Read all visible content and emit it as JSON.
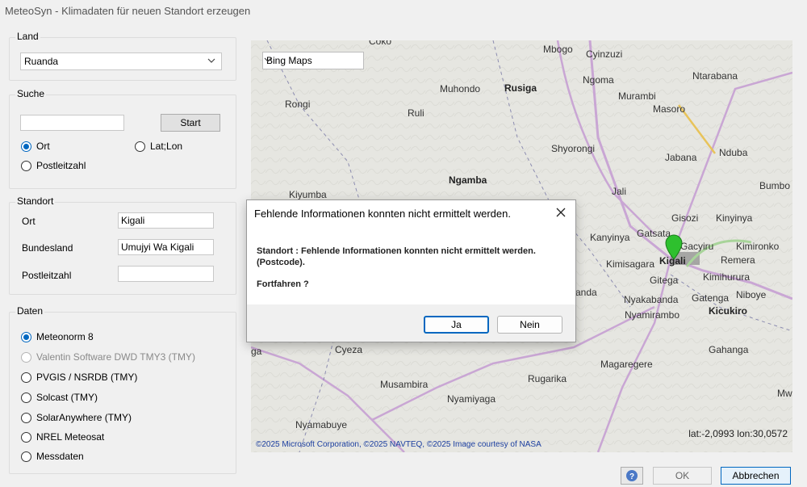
{
  "window": {
    "title": "MeteoSyn - Klimadaten für neuen Standort erzeugen"
  },
  "land": {
    "label": "Land",
    "selected": "Ruanda"
  },
  "suche": {
    "label": "Suche",
    "input_value": "",
    "start_label": "Start",
    "options": [
      "Ort",
      "Lat;Lon",
      "Postleitzahl"
    ],
    "selected": "Ort"
  },
  "standort": {
    "label": "Standort",
    "fields": [
      {
        "label": "Ort",
        "value": "Kigali"
      },
      {
        "label": "Bundesland",
        "value": "Umujyi Wa Kigali"
      },
      {
        "label": "Postleitzahl",
        "value": ""
      }
    ]
  },
  "daten": {
    "label": "Daten",
    "options": [
      "Meteonorm 8",
      "Valentin Software DWD TMY3 (TMY)",
      "PVGIS / NSRDB (TMY)",
      "Solcast (TMY)",
      "SolarAnywhere (TMY)",
      "NREL Meteosat",
      "Messdaten"
    ],
    "selected": "Meteonorm 8",
    "disabled": "Valentin Software DWD TMY3 (TMY)"
  },
  "map": {
    "provider": "Bing Maps",
    "places": [
      "Coko",
      "Mbogo",
      "Cyinzuzi",
      "Ngoma",
      "Ntarabana",
      "Muhondo",
      "Rusiga",
      "Murambi",
      "Rongi",
      "Ruli",
      "Masoro",
      "Shyorongi",
      "Jabana",
      "Nduba",
      "Ngamba",
      "Kiyumba",
      "Jali",
      "Bumbo",
      "Gisozi",
      "Kinyinya",
      "Kanyinya",
      "Gatsata",
      "Gacyiru",
      "Kimironko",
      "Kimisagara",
      "Kigali",
      "Remera",
      "Gitega",
      "Kimihurura",
      "Nyakabanda",
      "Gatenga",
      "Niboye",
      "Nyamirambo",
      "Kicukiro",
      "Gahanga",
      "Magaregere",
      "Cyeza",
      "Musambira",
      "Rugarika",
      "Nyamiyaga",
      "Nyamabuye",
      "Mwo",
      "anda",
      "ga"
    ],
    "copyright": "©2025 Microsoft Corporation, ©2025 NAVTEQ, ©2025 Image courtesy of NASA",
    "coords": "lat:-2,0993 lon:30,0572"
  },
  "dialog": {
    "title": "Fehlende Informationen konnten nicht ermittelt werden.",
    "message_line1": "Standort : Fehlende Informationen konnten nicht ermittelt werden.",
    "message_line2": "(Postcode).",
    "question": "Fortfahren ?",
    "yes_label": "Ja",
    "no_label": "Nein"
  },
  "footer": {
    "help_icon": "help-icon",
    "ok_label": "OK",
    "cancel_label": "Abbrechen"
  },
  "colors": {
    "accent": "#0067c0",
    "map_bg": "#e6e6e1",
    "road": "#c9a6d4",
    "marker": "#2ec02e"
  }
}
